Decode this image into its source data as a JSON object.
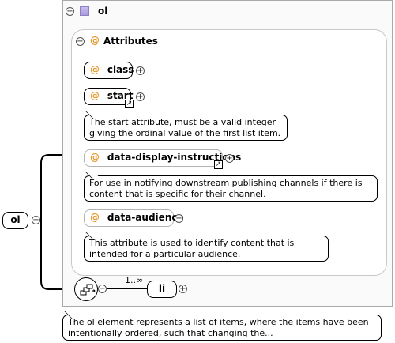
{
  "ol": {
    "title": "ol",
    "root_label": "ol",
    "documentation": "The ol element represents a list of items, where the items have been intentionally ordered, such that changing the..."
  },
  "attributes": {
    "header": "Attributes",
    "at_symbol": "@",
    "items": [
      {
        "name": "class"
      },
      {
        "name": "start",
        "doc": "The start attribute, must be a valid integer giving the ordinal value of the first list item."
      },
      {
        "name": "data-display-instructions",
        "doc": "For use in notifying downstream publishing channels if there is content that is specific for their channel."
      },
      {
        "name": "data-audience",
        "doc": "This attribute is used to identify content that is intended for a particular audience."
      }
    ]
  },
  "sequence": {
    "child": "li",
    "cardinality": "1..∞"
  },
  "icons": {
    "collapse": "minus-circle-icon",
    "expand": "plus-circle-icon",
    "attribute": "at-sign-icon",
    "link": "link-arrow-icon",
    "sequence": "sequence-compositor-icon",
    "element": "element-square-icon"
  },
  "colors": {
    "attribute_symbol": "#e69a2e",
    "element_icon": "#b8adea"
  }
}
